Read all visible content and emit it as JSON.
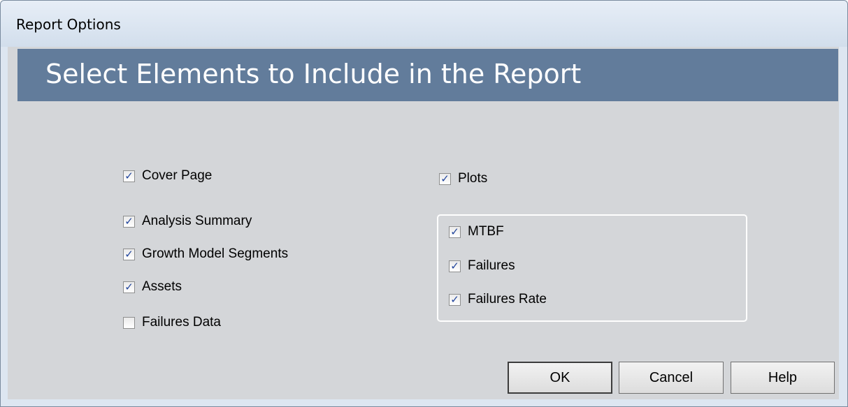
{
  "window": {
    "title": "Report Options"
  },
  "header": {
    "title": "Select Elements to Include in the Report"
  },
  "left_options": [
    {
      "label": "Cover Page",
      "checked": true
    },
    {
      "label": "Analysis Summary",
      "checked": true
    },
    {
      "label": "Growth Model Segments",
      "checked": true
    },
    {
      "label": "Assets",
      "checked": true
    },
    {
      "label": "Failures Data",
      "checked": false
    }
  ],
  "plots": {
    "label": "Plots",
    "checked": true,
    "items": [
      {
        "label": "MTBF",
        "checked": true
      },
      {
        "label": "Failures",
        "checked": true
      },
      {
        "label": "Failures Rate",
        "checked": true
      }
    ]
  },
  "buttons": {
    "ok": "OK",
    "cancel": "Cancel",
    "help": "Help"
  },
  "colors": {
    "header_banner": "#627c9b",
    "dialog_background": "#d4d6d9",
    "check_mark": "#21459c"
  }
}
